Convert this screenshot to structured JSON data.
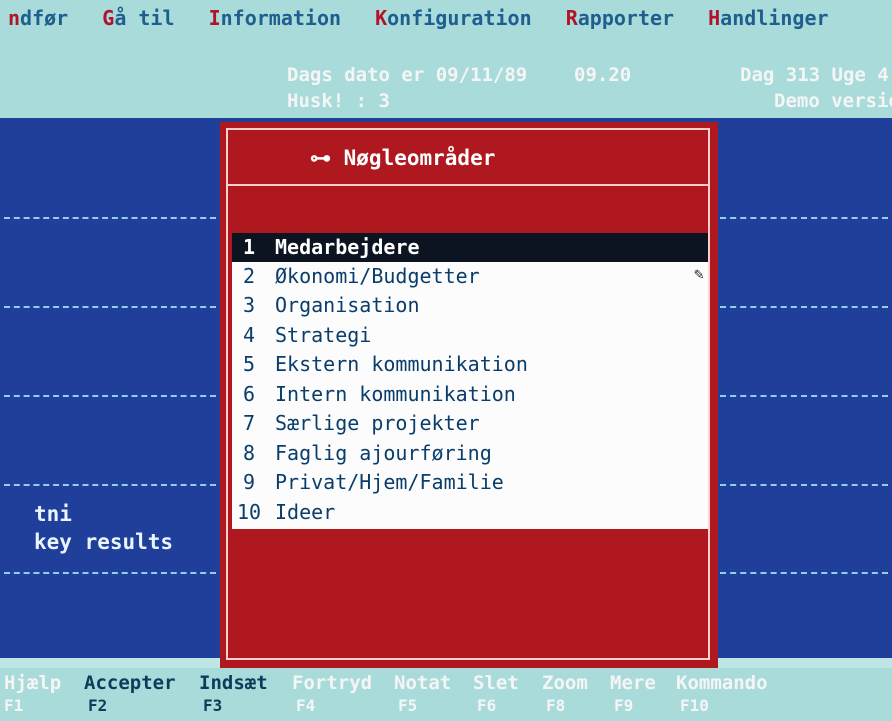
{
  "menubar": {
    "items": [
      {
        "hotkey": "n",
        "rest": "dfør"
      },
      {
        "hotkey": "G",
        "rest": "å til"
      },
      {
        "hotkey": "I",
        "rest": "nformation"
      },
      {
        "hotkey": "K",
        "rest": "onfiguration"
      },
      {
        "hotkey": "R",
        "rest": "apporter"
      },
      {
        "hotkey": "H",
        "rest": "andlinger"
      }
    ]
  },
  "status": {
    "date_text": "Dags dato er 09/11/89",
    "time": "09.20",
    "day_week": "Dag 313  Uge 4",
    "reminder": "Husk! : 3",
    "version": "Demo versio"
  },
  "sidebar": {
    "line1": "tni",
    "line2": "key results"
  },
  "dialog": {
    "title": "⊶ Nøgleområder",
    "cursor_glyph": "✎",
    "items": [
      {
        "num": "1",
        "label": "Medarbejdere"
      },
      {
        "num": "2",
        "label": "Økonomi/Budgetter"
      },
      {
        "num": "3",
        "label": "Organisation"
      },
      {
        "num": "4",
        "label": "Strategi"
      },
      {
        "num": "5",
        "label": "Ekstern kommunikation"
      },
      {
        "num": "6",
        "label": "Intern kommunikation"
      },
      {
        "num": "7",
        "label": "Særlige projekter"
      },
      {
        "num": "8",
        "label": "Faglig ajourføring"
      },
      {
        "num": "9",
        "label": "Privat/Hjem/Familie"
      },
      {
        "num": "10",
        "label": "Ideer"
      }
    ],
    "selected_index": 0
  },
  "function_keys": [
    {
      "label": "Hjælp",
      "key": "F1"
    },
    {
      "label": "Accepter",
      "key": "F2"
    },
    {
      "label": "Indsæt",
      "key": "F3"
    },
    {
      "label": "Fortryd",
      "key": "F4"
    },
    {
      "label": "Notat",
      "key": "F5"
    },
    {
      "label": "Slet",
      "key": "F6"
    },
    {
      "label": "Zoom",
      "key": "F8"
    },
    {
      "label": "Mere",
      "key": "F9"
    },
    {
      "label": "Kommando",
      "key": "F10"
    }
  ],
  "colors": {
    "dialog_red": "#b01820",
    "background_blue": "#1f3f9a",
    "top_cyan": "#a9dbda",
    "selection_dark": "#0b1420"
  }
}
